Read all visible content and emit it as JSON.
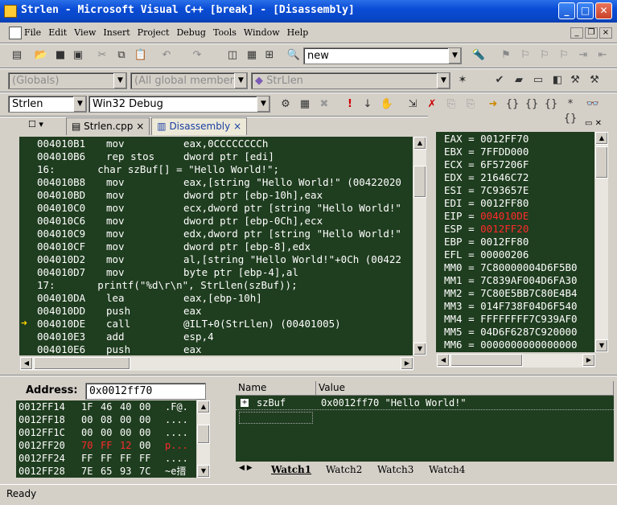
{
  "window": {
    "title": "Strlen - Microsoft Visual C++ [break] - [Disassembly]"
  },
  "menu": [
    "File",
    "Edit",
    "View",
    "Insert",
    "Project",
    "Debug",
    "Tools",
    "Window",
    "Help"
  ],
  "toolbar": {
    "find_value": "new",
    "globals": "(Globals)",
    "members": "(All global members",
    "function": "StrLlen",
    "project": "Strlen",
    "config": "Win32 Debug"
  },
  "tabs": [
    {
      "label": "Strlen.cpp"
    },
    {
      "label": "Disassembly"
    }
  ],
  "disasm": [
    {
      "addr": "004010B1",
      "mn": "mov",
      "op": "eax,0CCCCCCCCh"
    },
    {
      "addr": "004010B6",
      "mn": "rep stos",
      "op": "dword ptr [edi]"
    },
    {
      "src": "16:       char szBuf[] = \"Hello World!\";"
    },
    {
      "addr": "004010B8",
      "mn": "mov",
      "op": "eax,[string \"Hello World!\" (00422020"
    },
    {
      "addr": "004010BD",
      "mn": "mov",
      "op": "dword ptr [ebp-10h],eax"
    },
    {
      "addr": "004010C0",
      "mn": "mov",
      "op": "ecx,dword ptr [string \"Hello World!\""
    },
    {
      "addr": "004010C6",
      "mn": "mov",
      "op": "dword ptr [ebp-0Ch],ecx"
    },
    {
      "addr": "004010C9",
      "mn": "mov",
      "op": "edx,dword ptr [string \"Hello World!\""
    },
    {
      "addr": "004010CF",
      "mn": "mov",
      "op": "dword ptr [ebp-8],edx"
    },
    {
      "addr": "004010D2",
      "mn": "mov",
      "op": "al,[string \"Hello World!\"+0Ch (00422"
    },
    {
      "addr": "004010D7",
      "mn": "mov",
      "op": "byte ptr [ebp-4],al"
    },
    {
      "src": "17:       printf(\"%d\\r\\n\", StrLlen(szBuf));"
    },
    {
      "addr": "004010DA",
      "mn": "lea",
      "op": "eax,[ebp-10h]"
    },
    {
      "addr": "004010DD",
      "mn": "push",
      "op": "eax"
    },
    {
      "addr": "004010DE",
      "mn": "call",
      "op": "@ILT+0(StrLlen) (00401005)",
      "current": true
    },
    {
      "addr": "004010E3",
      "mn": "add",
      "op": "esp,4"
    },
    {
      "addr": "004010E6",
      "mn": "push",
      "op": "eax"
    }
  ],
  "registers": [
    {
      "name": "EAX",
      "value": "0012FF70"
    },
    {
      "name": "EBX",
      "value": "7FFDD000"
    },
    {
      "name": "ECX",
      "value": "6F57206F"
    },
    {
      "name": "EDX",
      "value": "21646C72"
    },
    {
      "name": "ESI",
      "value": "7C93657E"
    },
    {
      "name": "EDI",
      "value": "0012FF80"
    },
    {
      "name": "EIP",
      "value": "004010DE",
      "changed": true
    },
    {
      "name": "ESP",
      "value": "0012FF20",
      "changed": true
    },
    {
      "name": "EBP",
      "value": "0012FF80"
    },
    {
      "name": "EFL",
      "value": "00000206"
    },
    {
      "name": "MM0",
      "value": "7C80000004D6F5B0"
    },
    {
      "name": "MM1",
      "value": "7C839AF004D6FA30"
    },
    {
      "name": "MM2",
      "value": "7C80E5BB7C80E4B4"
    },
    {
      "name": "MM3",
      "value": "014F738F04D6F540"
    },
    {
      "name": "MM4",
      "value": "FFFFFFFF7C939AF0"
    },
    {
      "name": "MM5",
      "value": "04D6F6287C920000"
    },
    {
      "name": "MM6",
      "value": "0000000000000000"
    }
  ],
  "memory": {
    "address_label": "Address:",
    "address_value": "0x0012ff70",
    "rows": [
      {
        "addr": "0012FF14",
        "bytes": [
          "1F",
          "46",
          "40",
          "00"
        ],
        "ascii": ".F@."
      },
      {
        "addr": "0012FF18",
        "bytes": [
          "00",
          "08",
          "00",
          "00"
        ],
        "ascii": "...."
      },
      {
        "addr": "0012FF1C",
        "bytes": [
          "00",
          "00",
          "00",
          "00"
        ],
        "ascii": "...."
      },
      {
        "addr": "0012FF20",
        "bytes": [
          "70",
          "FF",
          "12",
          "00"
        ],
        "ascii": "p...",
        "changed": true
      },
      {
        "addr": "0012FF24",
        "bytes": [
          "FF",
          "FF",
          "FF",
          "FF"
        ],
        "ascii": "...."
      },
      {
        "addr": "0012FF28",
        "bytes": [
          "7E",
          "65",
          "93",
          "7C"
        ],
        "ascii": "~e搢"
      }
    ]
  },
  "watch": {
    "col_name": "Name",
    "col_value": "Value",
    "rows": [
      {
        "name": "szBuf",
        "value": "0x0012ff70 \"Hello World!\""
      }
    ],
    "tabs": [
      "Watch1",
      "Watch2",
      "Watch3",
      "Watch4"
    ]
  },
  "status": {
    "text": "Ready"
  }
}
